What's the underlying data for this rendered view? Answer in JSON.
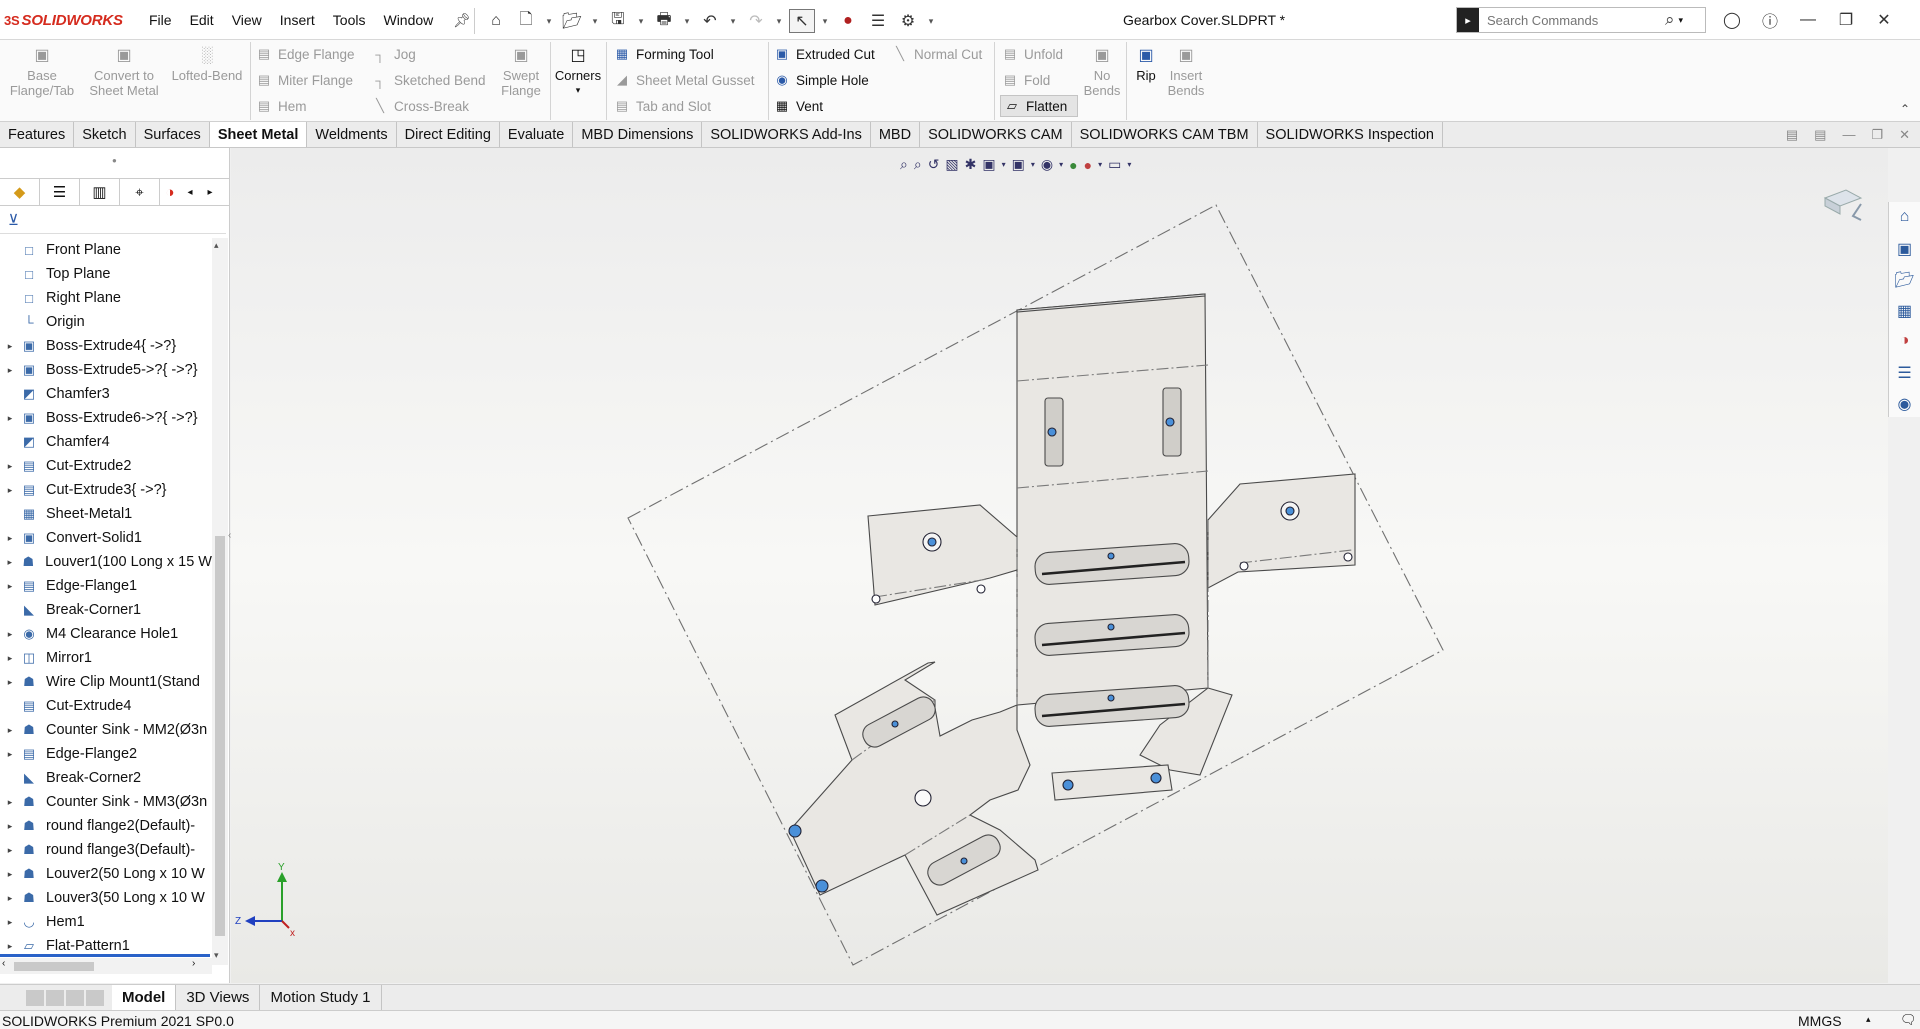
{
  "app": {
    "brand_ds": "3S",
    "brand_name": "SOLIDWORKS"
  },
  "menu": [
    "File",
    "Edit",
    "View",
    "Insert",
    "Tools",
    "Window"
  ],
  "document_title": "Gearbox Cover.SLDPRT *",
  "search": {
    "placeholder": "Search Commands"
  },
  "ribbon": {
    "base_flange": [
      "Base",
      "Flange/Tab"
    ],
    "convert_sheet_metal": [
      "Convert to",
      "Sheet Metal"
    ],
    "lofted_bend": "Lofted-Bend",
    "edge_flange": "Edge Flange",
    "miter_flange": "Miter Flange",
    "hem": "Hem",
    "jog": "Jog",
    "sketched_bend": "Sketched Bend",
    "cross_break": "Cross-Break",
    "swept_flange": [
      "Swept",
      "Flange"
    ],
    "corners": "Corners",
    "forming_tool": "Forming Tool",
    "sheet_metal_gusset": "Sheet Metal Gusset",
    "tab_and_slot": "Tab and Slot",
    "extruded_cut": "Extruded Cut",
    "simple_hole": "Simple Hole",
    "vent": "Vent",
    "normal_cut": "Normal Cut",
    "unfold": "Unfold",
    "fold": "Fold",
    "flatten": "Flatten",
    "no_bends": [
      "No",
      "Bends"
    ],
    "rip": "Rip",
    "insert_bends": [
      "Insert",
      "Bends"
    ]
  },
  "tabs": [
    {
      "label": "Features",
      "active": false
    },
    {
      "label": "Sketch",
      "active": false
    },
    {
      "label": "Surfaces",
      "active": false
    },
    {
      "label": "Sheet Metal",
      "active": true
    },
    {
      "label": "Weldments",
      "active": false
    },
    {
      "label": "Direct Editing",
      "active": false
    },
    {
      "label": "Evaluate",
      "active": false
    },
    {
      "label": "MBD Dimensions",
      "active": false
    },
    {
      "label": "SOLIDWORKS Add-Ins",
      "active": false
    },
    {
      "label": "MBD",
      "active": false
    },
    {
      "label": "SOLIDWORKS CAM",
      "active": false
    },
    {
      "label": "SOLIDWORKS CAM TBM",
      "active": false
    },
    {
      "label": "SOLIDWORKS Inspection",
      "active": false
    }
  ],
  "feature_tree": [
    {
      "label": "Front Plane",
      "expandable": false,
      "icon": "plane-icon"
    },
    {
      "label": "Top Plane",
      "expandable": false,
      "icon": "plane-icon"
    },
    {
      "label": "Right Plane",
      "expandable": false,
      "icon": "plane-icon"
    },
    {
      "label": "Origin",
      "expandable": false,
      "icon": "origin-icon"
    },
    {
      "label": "Boss-Extrude4{ ->?}",
      "expandable": true,
      "icon": "extrude-icon"
    },
    {
      "label": "Boss-Extrude5->?{ ->?}",
      "expandable": true,
      "icon": "extrude-icon"
    },
    {
      "label": "Chamfer3",
      "expandable": false,
      "icon": "chamfer-icon"
    },
    {
      "label": "Boss-Extrude6->?{ ->?}",
      "expandable": true,
      "icon": "extrude-icon"
    },
    {
      "label": "Chamfer4",
      "expandable": false,
      "icon": "chamfer-icon"
    },
    {
      "label": "Cut-Extrude2",
      "expandable": true,
      "icon": "cut-icon"
    },
    {
      "label": "Cut-Extrude3{ ->?}",
      "expandable": true,
      "icon": "cut-icon"
    },
    {
      "label": "Sheet-Metal1",
      "expandable": false,
      "icon": "sheet-metal-icon"
    },
    {
      "label": "Convert-Solid1",
      "expandable": true,
      "icon": "convert-icon"
    },
    {
      "label": "Louver1(100 Long x 15 W",
      "expandable": true,
      "icon": "forming-icon"
    },
    {
      "label": "Edge-Flange1",
      "expandable": true,
      "icon": "edge-flange-icon"
    },
    {
      "label": "Break-Corner1",
      "expandable": false,
      "icon": "break-corner-icon"
    },
    {
      "label": "M4 Clearance Hole1",
      "expandable": true,
      "icon": "hole-icon"
    },
    {
      "label": "Mirror1",
      "expandable": true,
      "icon": "mirror-icon"
    },
    {
      "label": "Wire Clip Mount1(Stand",
      "expandable": true,
      "icon": "forming-icon"
    },
    {
      "label": "Cut-Extrude4",
      "expandable": false,
      "icon": "cut-icon"
    },
    {
      "label": "Counter Sink - MM2(Ø3n",
      "expandable": true,
      "icon": "forming-icon"
    },
    {
      "label": "Edge-Flange2",
      "expandable": true,
      "icon": "edge-flange-icon"
    },
    {
      "label": "Break-Corner2",
      "expandable": false,
      "icon": "break-corner-icon"
    },
    {
      "label": "Counter Sink - MM3(Ø3n",
      "expandable": true,
      "icon": "forming-icon"
    },
    {
      "label": "round flange2(Default)-",
      "expandable": true,
      "icon": "forming-icon"
    },
    {
      "label": "round flange3(Default)-",
      "expandable": true,
      "icon": "forming-icon"
    },
    {
      "label": "Louver2(50 Long x 10 W",
      "expandable": true,
      "icon": "forming-icon"
    },
    {
      "label": "Louver3(50 Long x 10 W",
      "expandable": true,
      "icon": "forming-icon"
    },
    {
      "label": "Hem1",
      "expandable": true,
      "icon": "hem-icon"
    },
    {
      "label": "Flat-Pattern1",
      "expandable": true,
      "icon": "flat-pattern-icon"
    }
  ],
  "triad": {
    "x": "x",
    "y": "Y",
    "z": "Z"
  },
  "bottom_tabs": [
    {
      "label": "Model",
      "active": true
    },
    {
      "label": "3D Views",
      "active": false
    },
    {
      "label": "Motion Study 1",
      "active": false
    }
  ],
  "status": {
    "version": "SOLIDWORKS Premium 2021 SP0.0",
    "units": "MMGS"
  }
}
